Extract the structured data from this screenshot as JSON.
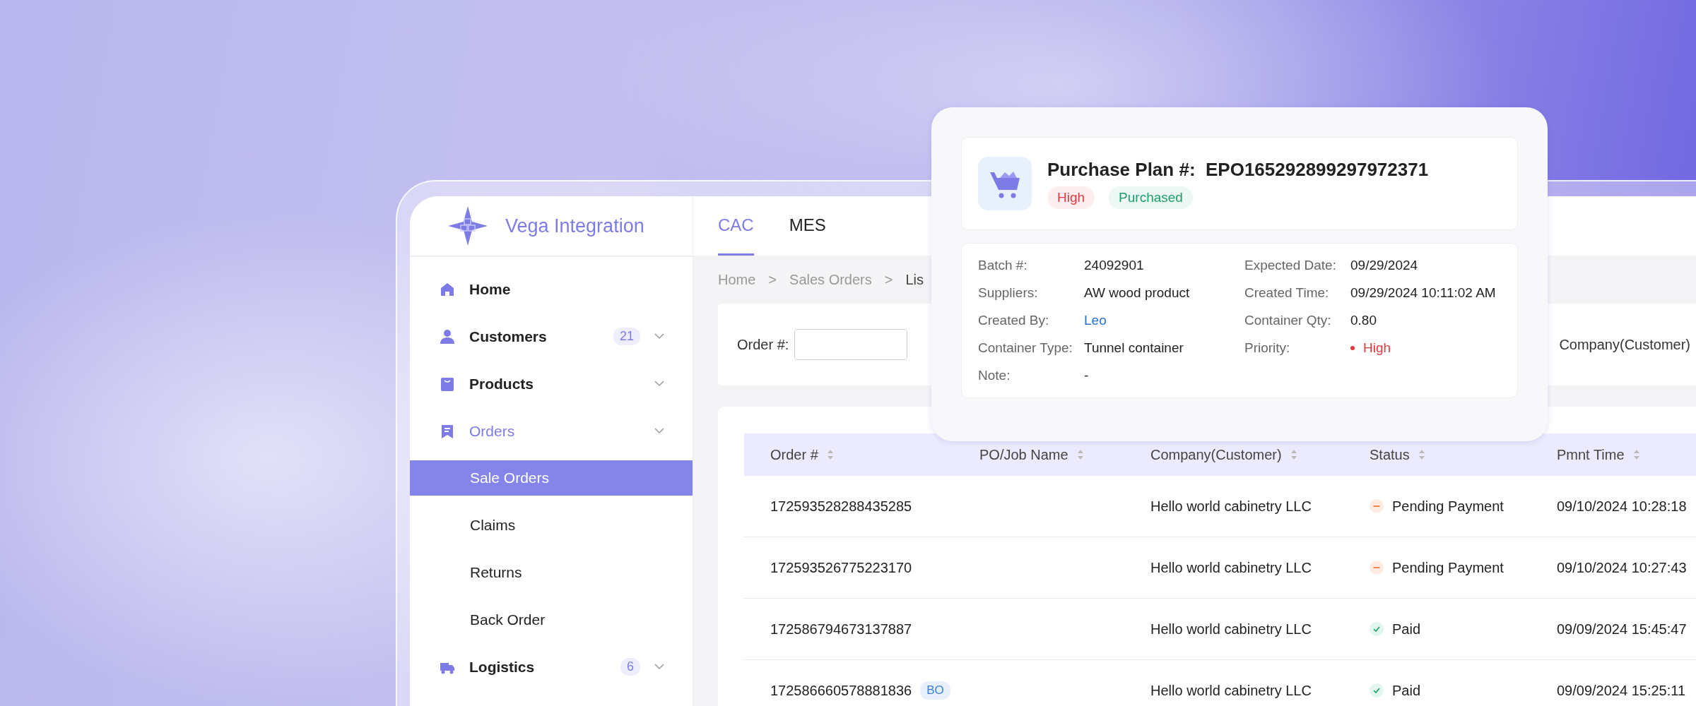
{
  "sidebar": {
    "brand": "Vega Integration",
    "items": [
      {
        "label": "Home",
        "kind": "home",
        "selected": false
      },
      {
        "label": "Customers",
        "kind": "person",
        "badge": "21",
        "expanded": false,
        "selected": false
      },
      {
        "label": "Products",
        "kind": "box",
        "expanded": false,
        "selected": false
      },
      {
        "label": "Orders",
        "kind": "document",
        "expanded": true,
        "selected": true,
        "children": [
          {
            "label": "Sale Orders",
            "selected": true
          },
          {
            "label": "Claims",
            "selected": false
          },
          {
            "label": "Returns",
            "selected": false
          },
          {
            "label": "Back Order",
            "selected": false
          }
        ]
      },
      {
        "label": "Logistics",
        "kind": "truck",
        "badge": "6",
        "expanded": false,
        "selected": false
      }
    ]
  },
  "tabs": [
    {
      "label": "CAC",
      "selected": true
    },
    {
      "label": "MES",
      "selected": false
    }
  ],
  "breadcrumb": [
    "Home",
    "Sales Orders",
    "Lis"
  ],
  "breadcrumb_separator": ">",
  "filters": [
    {
      "label": "Order #:"
    },
    {
      "label": "Company(Customer)"
    }
  ],
  "table": {
    "columns": [
      "Order #",
      "PO/Job Name",
      "Company(Customer)",
      "Status",
      "Pmnt Time"
    ],
    "rows": [
      {
        "order": "172593528288435285",
        "company": "Hello world cabinetry LLC",
        "kind": "pending",
        "status": "Pending Payment",
        "pmnt_time": "09/10/2024 10:28:18"
      },
      {
        "order": "172593526775223170",
        "company": "Hello world cabinetry LLC",
        "kind": "pending",
        "status": "Pending Payment",
        "pmnt_time": "09/10/2024 10:27:43"
      },
      {
        "order": "172586794673137887",
        "company": "Hello world cabinetry LLC",
        "kind": "paid",
        "status": "Paid",
        "pmnt_time": "09/09/2024 15:45:47"
      },
      {
        "order": "172586660578881836",
        "tag": "BO",
        "company": "Hello world cabinetry LLC",
        "kind": "paid",
        "status": "Paid",
        "pmnt_time": "09/09/2024 15:25:11"
      }
    ]
  },
  "popup": {
    "title": "Purchase Plan #:  EPO165292899297972371",
    "tags": [
      {
        "label": "High",
        "color": "#e0393e"
      },
      {
        "label": "Purchased",
        "color": "#1f9d6a"
      }
    ],
    "fields": [
      {
        "label": "Batch #:",
        "value": "24092901",
        "kind": "text"
      },
      {
        "label": "Expected Date:",
        "value": "09/29/2024",
        "kind": "text"
      },
      {
        "label": "Suppliers:",
        "value": "AW wood product",
        "kind": "text"
      },
      {
        "label": "Created Time:",
        "value": "09/29/2024 10:11:02 AM",
        "kind": "text"
      },
      {
        "label": "Created By:",
        "value": "Leo",
        "kind": "link"
      },
      {
        "label": "Container Qty:",
        "value": "0.80",
        "kind": "text"
      },
      {
        "label": "Container Type:",
        "value": "Tunnel container",
        "kind": "text"
      },
      {
        "label": "Priority:",
        "value": "High",
        "kind": "priority"
      },
      {
        "label": "Note:",
        "value": "-",
        "kind": "text"
      }
    ]
  }
}
